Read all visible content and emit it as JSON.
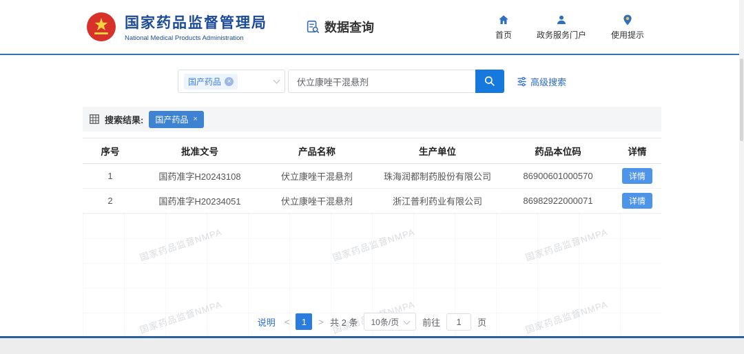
{
  "colors": {
    "primary": "#1778dd",
    "link": "#2b6cd4",
    "tag": "#3e82d2",
    "detail": "#4e94e8",
    "page_active": "#2b7ce0",
    "navy": "#1b4a9b",
    "icon_blue": "#2d6fc1",
    "divider": "#3674b5",
    "footer": "#2a5f9e"
  },
  "header": {
    "org_name_cn": "国家药品监督管理局",
    "org_name_en": "National Medical Products Administration",
    "page_title": "数据查询",
    "nav": [
      {
        "label": "首页",
        "icon": "home-icon"
      },
      {
        "label": "政务服务门户",
        "icon": "user-icon"
      },
      {
        "label": "使用提示",
        "icon": "pin-icon"
      }
    ]
  },
  "search": {
    "category_tag": "国产药品",
    "query": "伏立康唑干混悬剂",
    "advanced_label": "高级搜索"
  },
  "results": {
    "label": "搜索结果:",
    "filter_tag": "国产药品"
  },
  "table": {
    "columns": [
      "序号",
      "批准文号",
      "产品名称",
      "生产单位",
      "药品本位码",
      "详情"
    ],
    "rows": [
      {
        "index": "1",
        "approval_no": "国药准字H20243108",
        "product": "伏立康唑干混悬剂",
        "manufacturer": "珠海润都制药股份有限公司",
        "code": "86900601000570",
        "detail_label": "详情"
      },
      {
        "index": "2",
        "approval_no": "国药准字H20234051",
        "product": "伏立康唑干混悬剂",
        "manufacturer": "浙江普利药业有限公司",
        "code": "86982922000071",
        "detail_label": "详情"
      }
    ]
  },
  "pagination": {
    "note_label": "说明",
    "current_page": "1",
    "total_text": "共 2 条",
    "page_size": "10条/页",
    "goto_label": "前往",
    "goto_value": "1",
    "goto_suffix": "页"
  },
  "icons": {
    "tag_remove": "×",
    "filter_tag_close": "×",
    "prev_page": "<",
    "next_page": ">"
  },
  "watermark": "国家药品监督NMPA"
}
